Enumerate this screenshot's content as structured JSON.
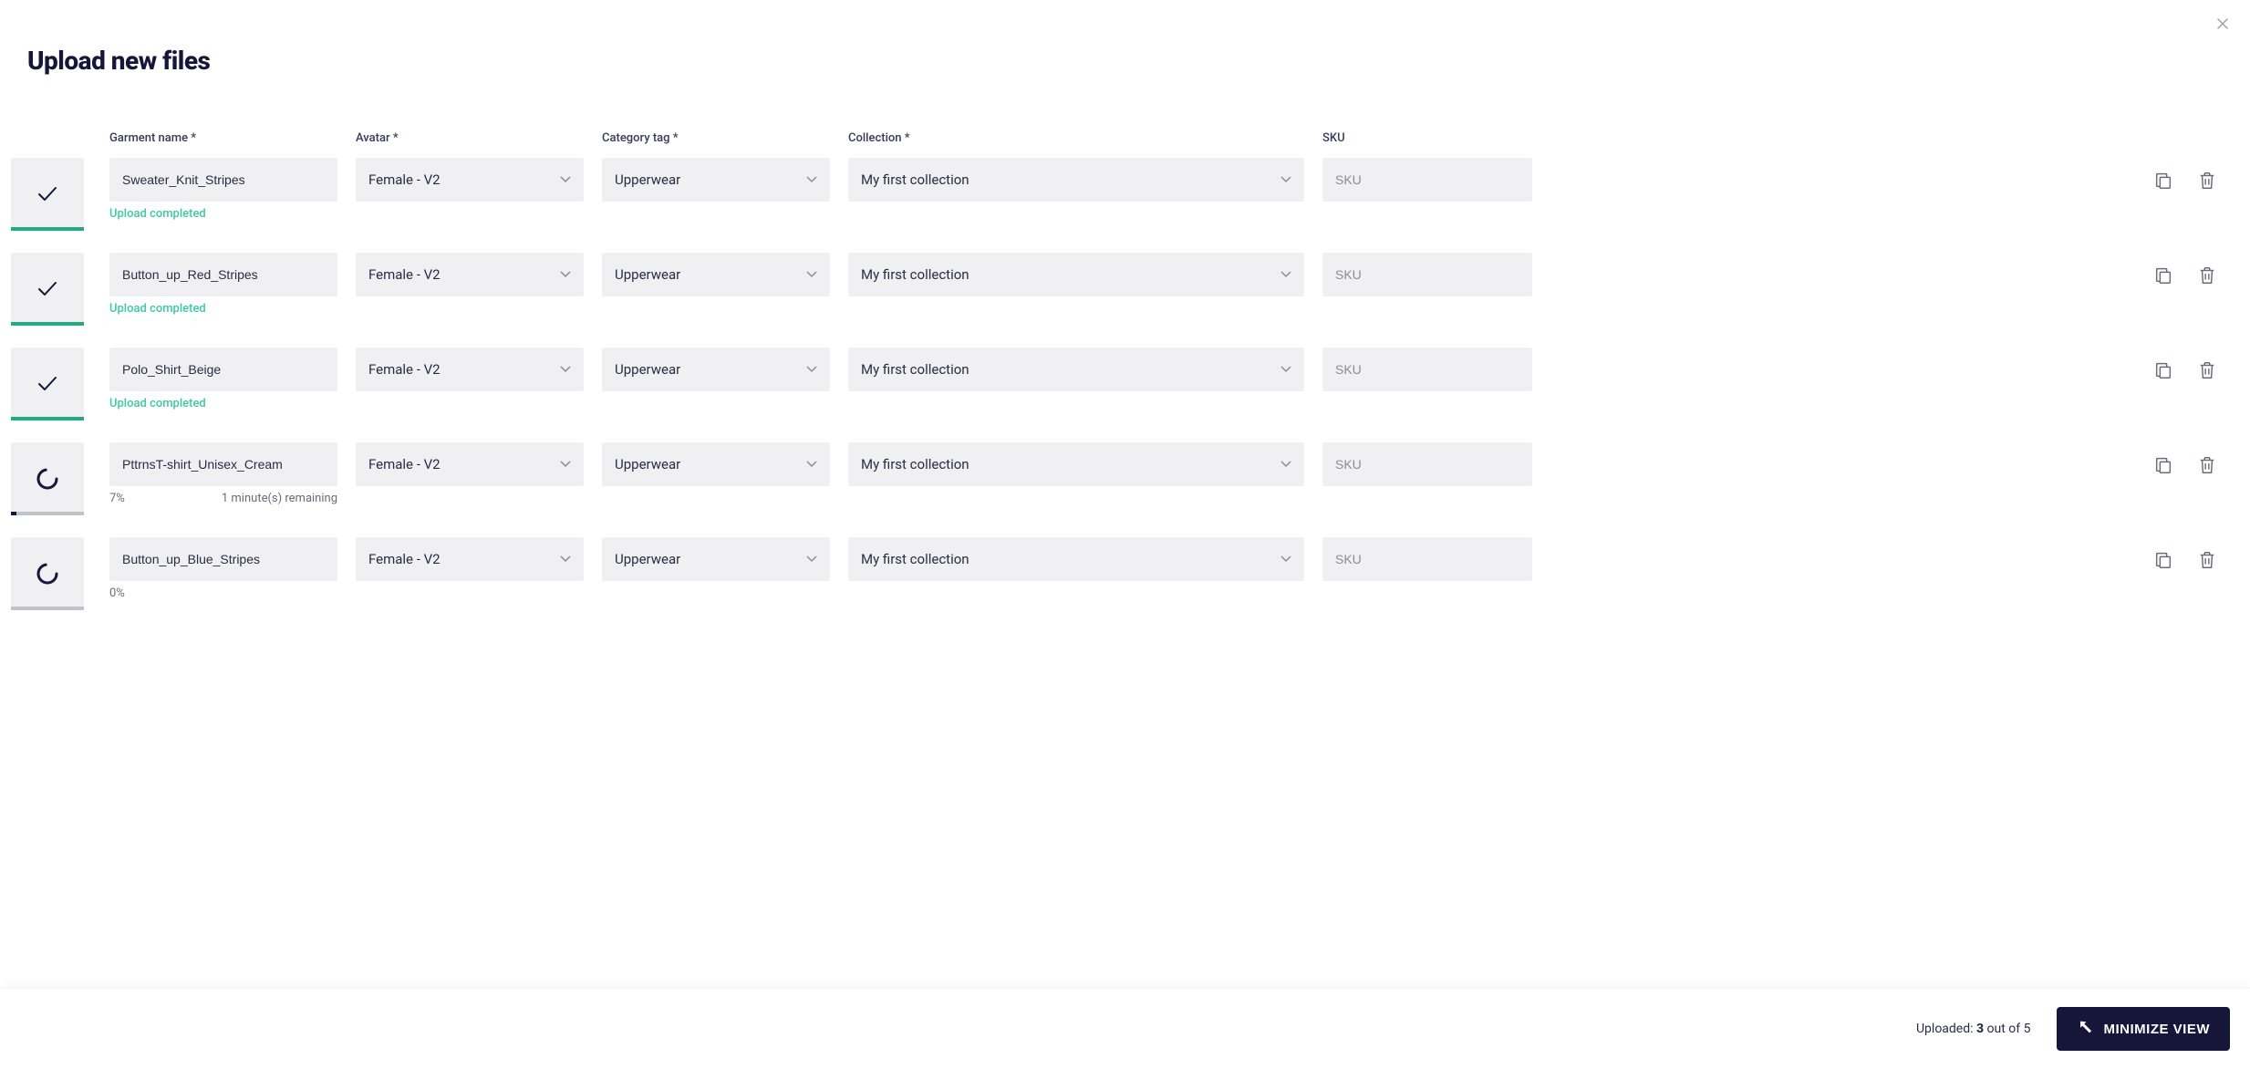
{
  "title": "Upload new files",
  "headers": {
    "garment": "Garment name *",
    "avatar": "Avatar *",
    "category": "Category tag *",
    "collection": "Collection *",
    "sku": "SKU"
  },
  "defaults": {
    "avatar": "Female - V2",
    "category": "Upperwear",
    "collection": "My first collection",
    "sku_placeholder": "SKU"
  },
  "status_labels": {
    "completed": "Upload completed"
  },
  "rows": [
    {
      "name": "Sweater_Knit_Stripes",
      "state": "completed",
      "progress": 100,
      "status_text": "Upload completed"
    },
    {
      "name": "Button_up_Red_Stripes",
      "state": "completed",
      "progress": 100,
      "status_text": "Upload completed"
    },
    {
      "name": "Polo_Shirt_Beige",
      "state": "completed",
      "progress": 100,
      "status_text": "Upload completed"
    },
    {
      "name": "PttrnsT-shirt_Unisex_Cream",
      "state": "uploading",
      "progress": 7,
      "percent_text": "7%",
      "remaining_text": "1 minute(s) remaining"
    },
    {
      "name": "Button_up_Blue_Stripes",
      "state": "uploading",
      "progress": 0,
      "percent_text": "0%",
      "remaining_text": ""
    }
  ],
  "footer": {
    "uploaded_label": "Uploaded: ",
    "uploaded_count": "3",
    "uploaded_suffix": " out of 5",
    "minimize_label": "MINIMIZE VIEW"
  }
}
